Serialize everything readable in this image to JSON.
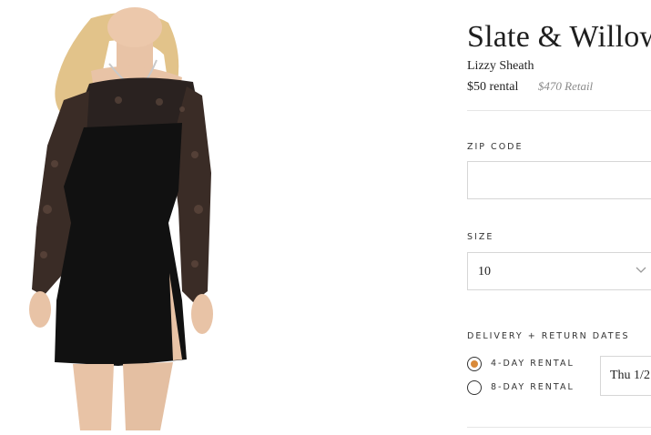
{
  "product": {
    "brand": "Slate & Willow",
    "name": "Lizzy Sheath",
    "rental_price": "$50 rental",
    "retail_price": "$470 Retail"
  },
  "zip": {
    "label": "ZIP CODE",
    "value": "",
    "placeholder": ""
  },
  "size": {
    "label": "SIZE",
    "selected": "10"
  },
  "delivery": {
    "label": "DELIVERY + RETURN DATES",
    "options": [
      {
        "label": "4-DAY RENTAL",
        "checked": true
      },
      {
        "label": "8-DAY RENTAL",
        "checked": false
      }
    ],
    "date_value": "Thu 1/2"
  },
  "colors": {
    "accent_radio": "#d98a3a",
    "dress": "#111111",
    "skin": "#e8c3a6",
    "hair": "#e2c38a"
  },
  "icons": {
    "size_dropdown": "chevron-down-icon"
  }
}
